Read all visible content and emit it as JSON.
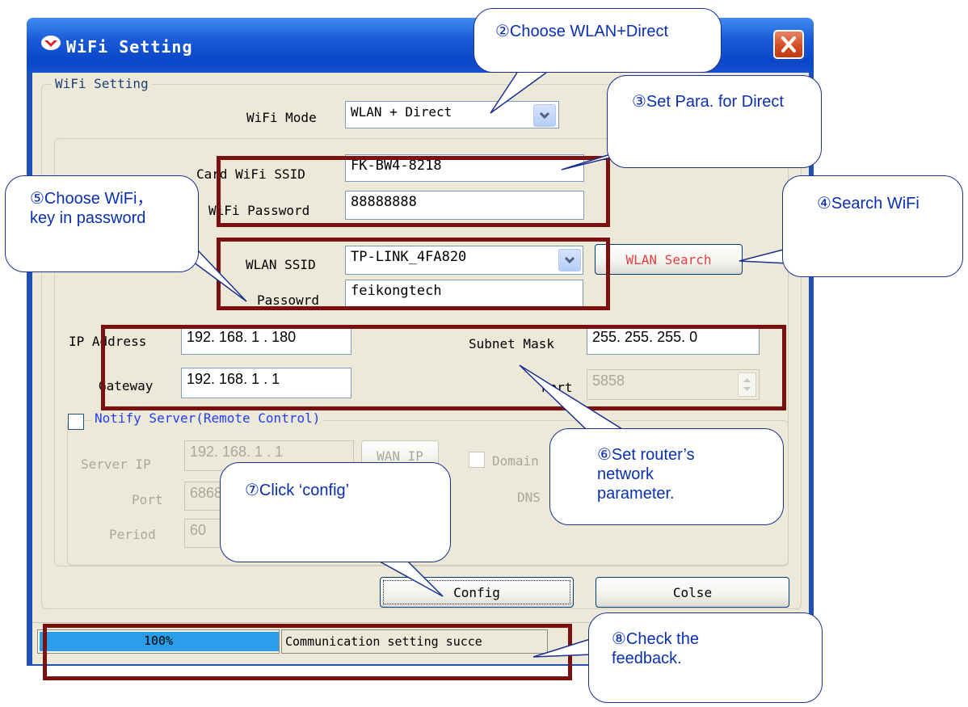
{
  "window": {
    "title": "WiFi Setting",
    "close_symbol": "✕"
  },
  "wifi_group": {
    "legend": "WiFi Setting",
    "mode_label": "WiFi Mode",
    "mode_value": "WLAN + Direct",
    "card_ssid_label": "Card WiFi SSID",
    "card_ssid_value": "FK-BW4-8218",
    "wifi_password_label": "WiFi Password",
    "wifi_password_value": "88888888",
    "wlan_ssid_label": "WLAN SSID",
    "wlan_ssid_value": "TP-LINK_4FA820",
    "wlan_search_label": "WLAN Search",
    "password_label": "Passowrd",
    "password_value": "feikongtech",
    "ip_label": "IP Address",
    "ip_value": "192. 168.  1 . 180",
    "subnet_label": "Subnet Mask",
    "subnet_value": "255. 255. 255.  0",
    "gateway_label": "Gateway",
    "gateway_value": "192. 168.  1 .  1",
    "port_label": "Port",
    "port_value": "5858"
  },
  "notify_group": {
    "legend": "Notify Server(Remote Control)",
    "server_ip_label": "Server IP",
    "server_ip_value": "192. 168.  1 .  1",
    "wan_ip_label": "WAN IP",
    "domain_label": "Domain",
    "port_label": "Port",
    "port_value": "6868",
    "dns_label": "DNS",
    "period_label": "Period",
    "period_value": "60"
  },
  "buttons": {
    "config": "Config",
    "close": "Colse"
  },
  "status": {
    "progress_text": "100%",
    "progress_value": 1.0,
    "message": "Communication setting succe"
  },
  "callouts": {
    "c2": "②Choose WLAN+Direct",
    "c3": "③Set Para. for Direct",
    "c4": "④Search WiFi",
    "c5": "⑤Choose WiFi，key in password",
    "c6": "⑥Set router’s network parameter.",
    "c7": "⑦Click ‘config’",
    "c8": "⑧Check the feedback."
  },
  "colors": {
    "titlebar": "#0a46c8",
    "client_bg": "#ece9d8",
    "annotation_box": "#7a1010",
    "callout_text": "#0a2fb0",
    "progress_fill": "#2a9ee8"
  }
}
